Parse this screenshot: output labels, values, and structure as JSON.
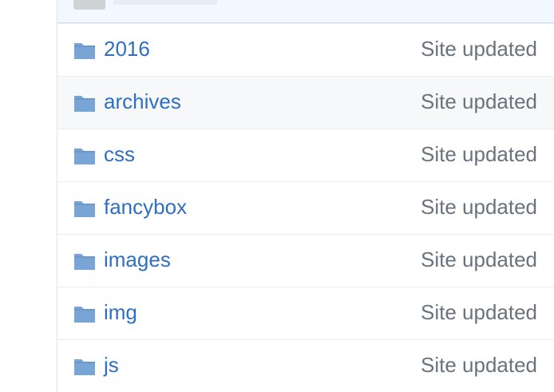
{
  "file_list": {
    "rows": [
      {
        "name": "2016",
        "message": "Site updated",
        "icon": "folder-icon"
      },
      {
        "name": "archives",
        "message": "Site updated",
        "icon": "folder-icon",
        "hovered": true
      },
      {
        "name": "css",
        "message": "Site updated",
        "icon": "folder-icon"
      },
      {
        "name": "fancybox",
        "message": "Site updated",
        "icon": "folder-icon"
      },
      {
        "name": "images",
        "message": "Site updated",
        "icon": "folder-icon"
      },
      {
        "name": "img",
        "message": "Site updated",
        "icon": "folder-icon"
      },
      {
        "name": "js",
        "message": "Site updated",
        "icon": "folder-icon"
      }
    ]
  },
  "colors": {
    "link": "#2f6fc0",
    "folder": "#79b8ff",
    "message": "#6a737d",
    "hover_row": "#f6f8fa",
    "commit_bar": "#f1f8ff"
  }
}
